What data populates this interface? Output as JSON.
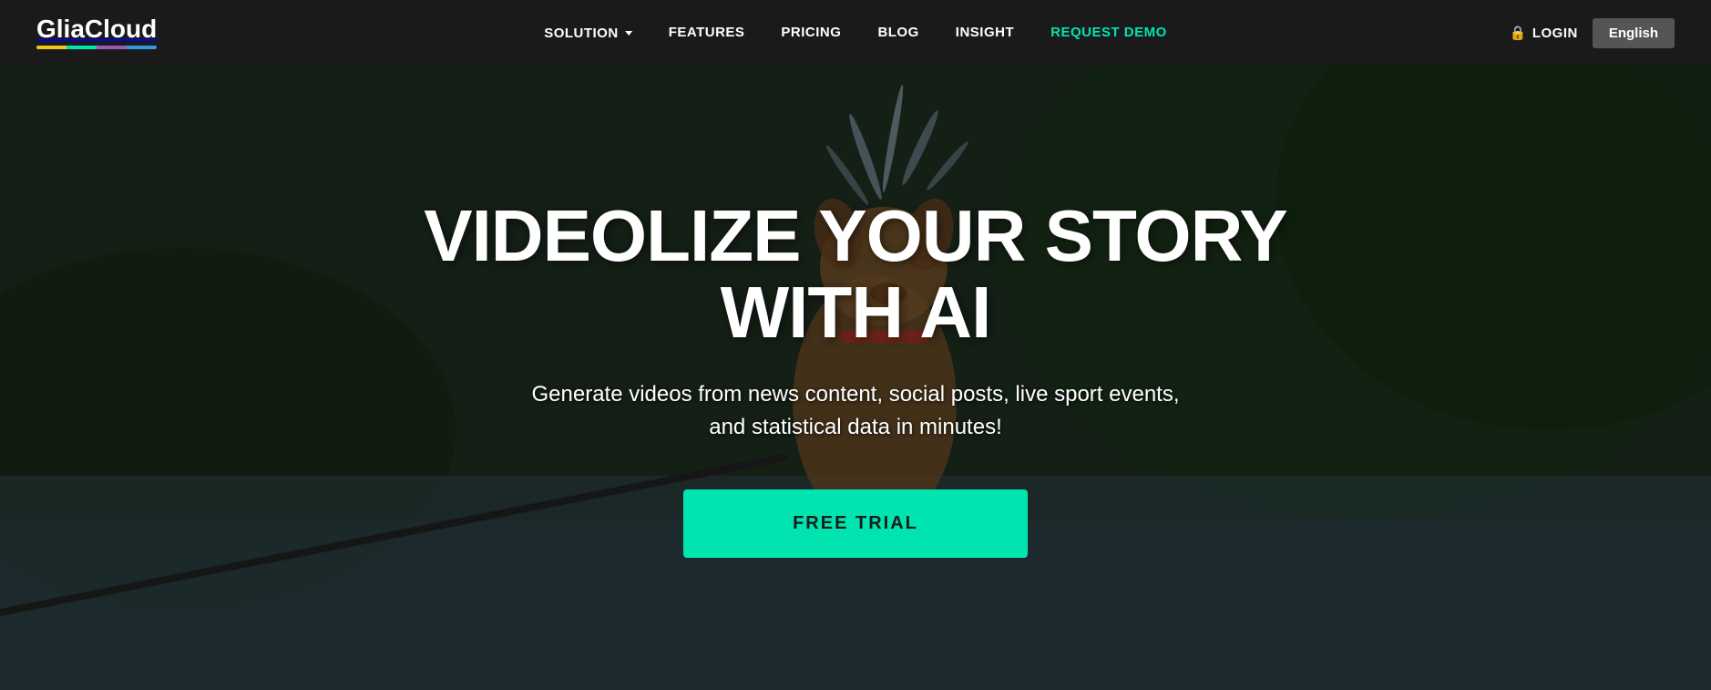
{
  "brand": {
    "name": "GliaCloud",
    "name_part1": "Glia",
    "name_part2": "Cloud"
  },
  "navbar": {
    "logo_label": "GliaCloud",
    "nav_items": [
      {
        "label": "SOLUTION",
        "has_dropdown": true,
        "class": "solution"
      },
      {
        "label": "FEATURES",
        "has_dropdown": false
      },
      {
        "label": "PRICING",
        "has_dropdown": false
      },
      {
        "label": "BLOG",
        "has_dropdown": false
      },
      {
        "label": "INSIGHT",
        "has_dropdown": false
      },
      {
        "label": "REQUEST DEMO",
        "has_dropdown": false,
        "class": "request-demo"
      }
    ],
    "login_label": "LOGIN",
    "language_label": "English"
  },
  "hero": {
    "headline_line1": "VIDEOLIZE YOUR STORY",
    "headline_line2": "WITH AI",
    "subheadline": "Generate videos from news content, social posts, live sport events,\nand statistical data in minutes!",
    "cta_label": "FREE TRIAL"
  },
  "colors": {
    "accent_teal": "#00e5b0",
    "navbar_bg": "#1a1a1a",
    "logo_underline_1": "#f5c518",
    "logo_underline_2": "#00e5b0",
    "logo_underline_3": "#9b59b6",
    "logo_underline_4": "#3498db"
  }
}
